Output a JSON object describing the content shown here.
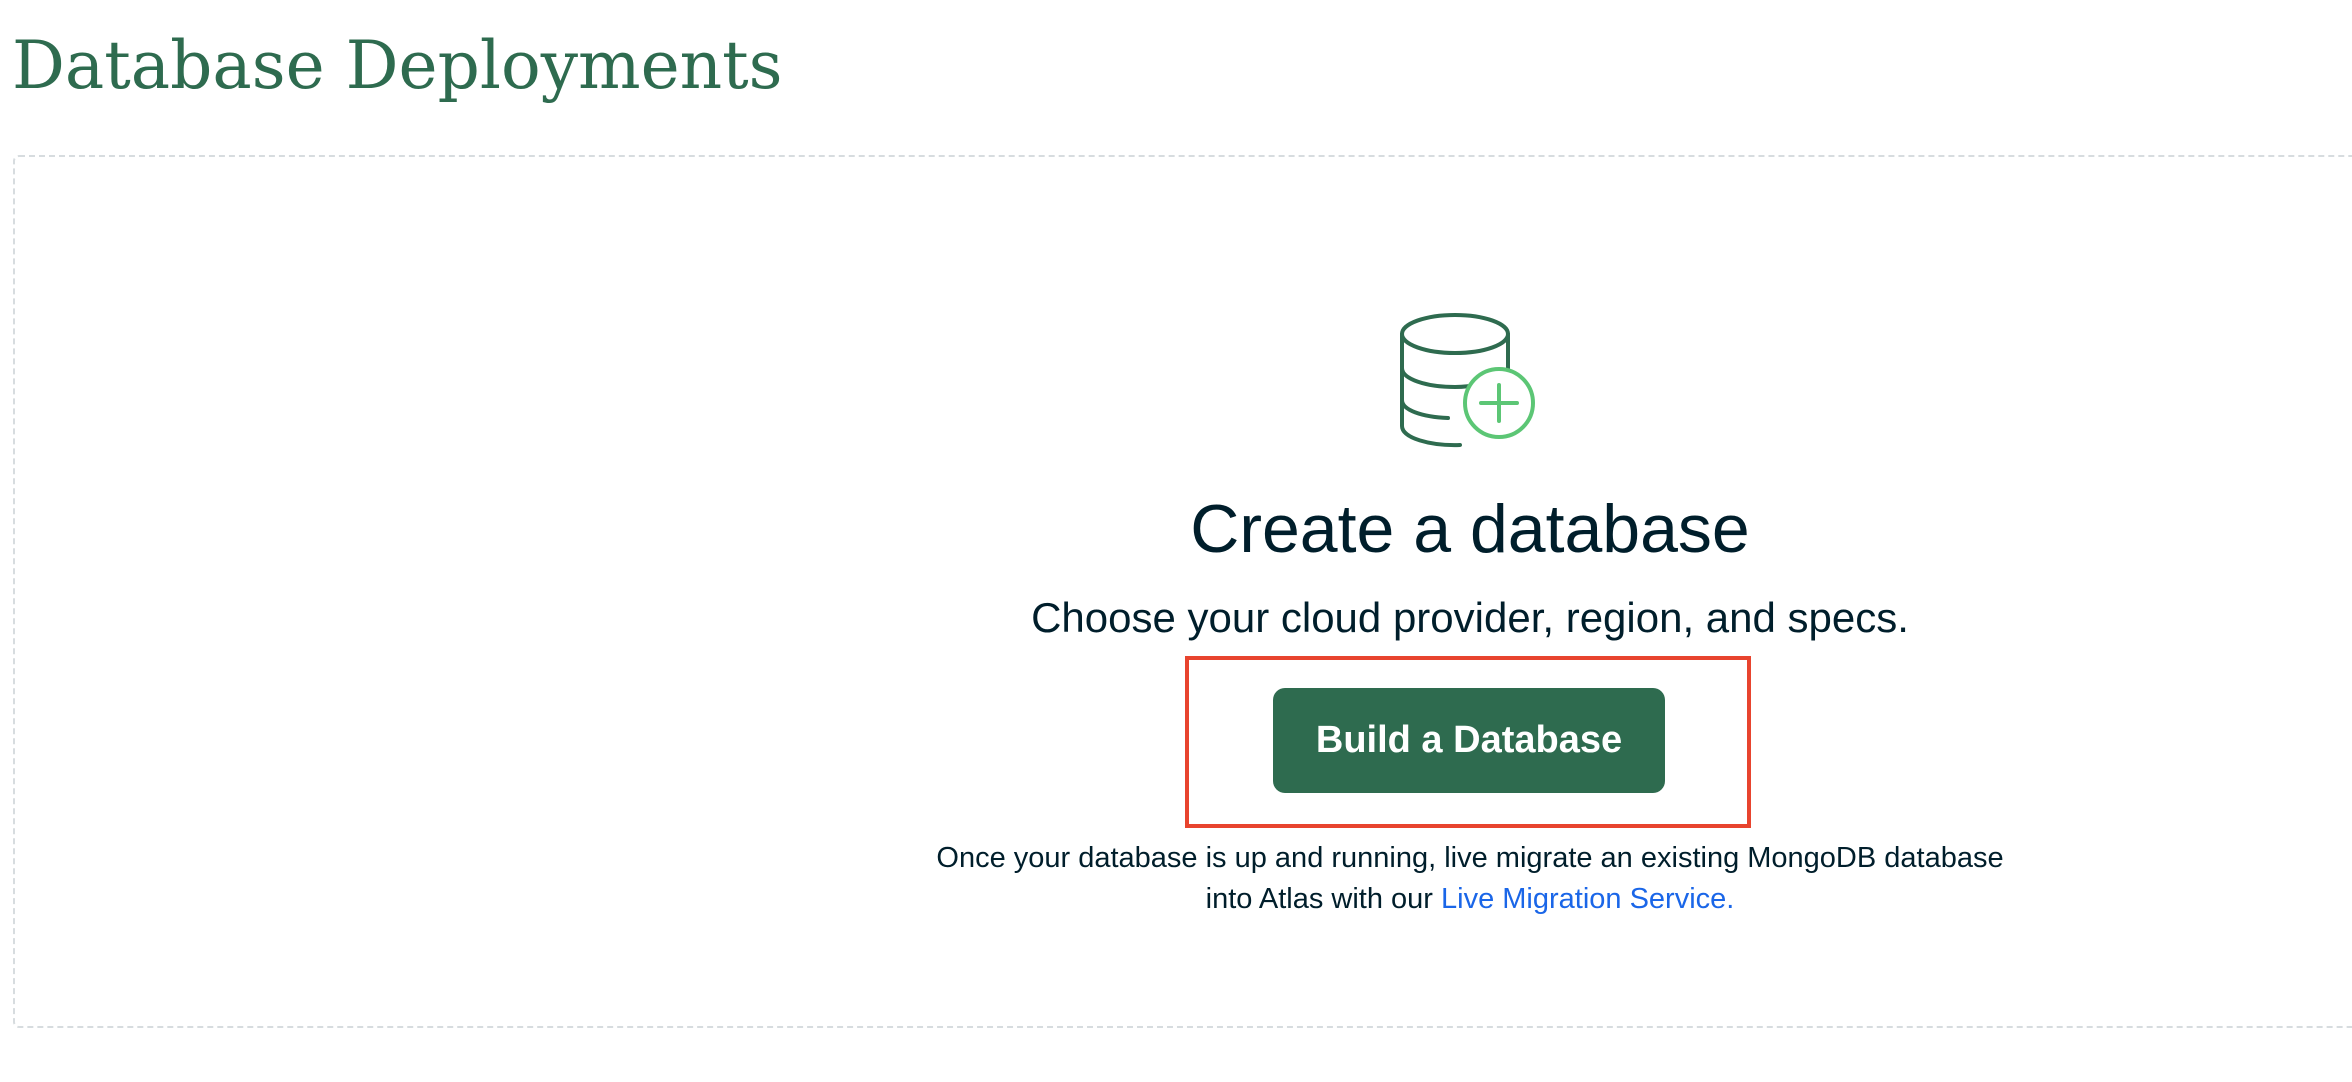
{
  "page": {
    "title": "Database Deployments"
  },
  "empty_state": {
    "icon": "database-plus-icon",
    "heading": "Create a database",
    "subtitle": "Choose your cloud provider, region, and specs.",
    "build_button_label": "Build a Database",
    "migration_line1": "Once your database is up and running, live migrate an existing MongoDB database",
    "migration_line2_prefix": "into Atlas with our ",
    "migration_link": "Live Migration Service."
  },
  "colors": {
    "brand_green": "#2e6b4f",
    "accent_green": "#5cc675",
    "link_blue": "#1a66e8",
    "text_dark": "#001e2b",
    "highlight_red": "#e8442e",
    "panel_border": "#d7dcdf"
  }
}
